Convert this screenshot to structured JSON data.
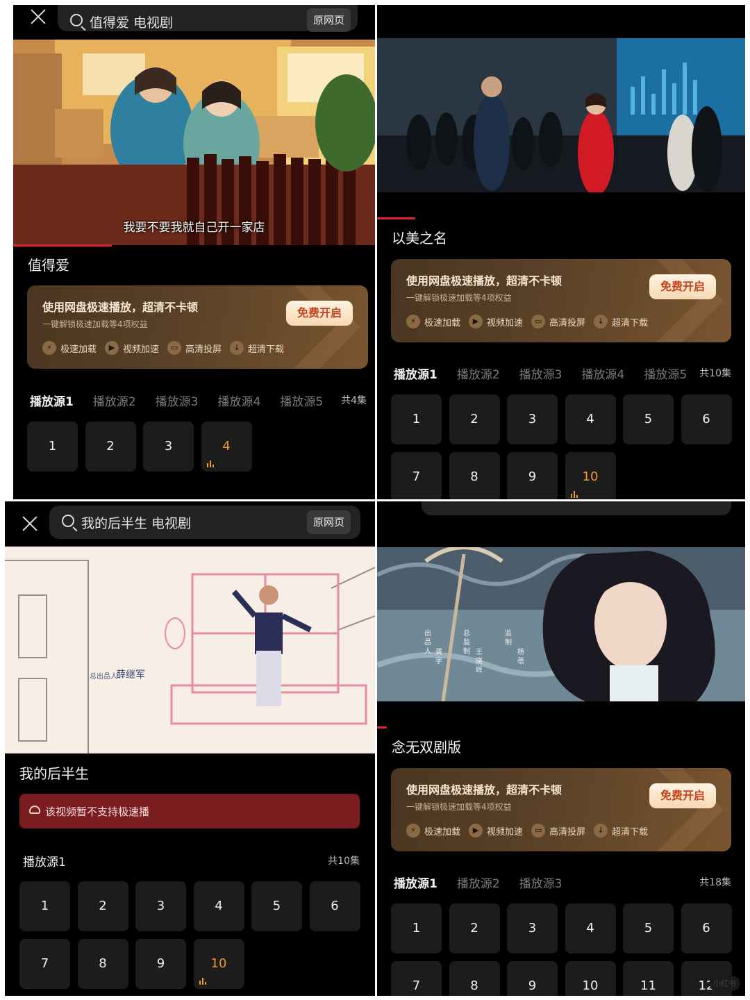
{
  "panels": [
    {
      "search": {
        "query": "值得爱 电视剧",
        "original_page": "原网页"
      },
      "subtitle": "我要不要我就自己开一家店",
      "title": "值得爱",
      "promo": {
        "title": "使用网盘极速播放，超清不卡顿",
        "subtitle": "一键解锁极速加载等4项权益",
        "button": "免费开启",
        "features": [
          "极速加载",
          "视频加速",
          "高清投屏",
          "超清下载"
        ]
      },
      "sources": [
        "播放源1",
        "播放源2",
        "播放源3",
        "播放源4",
        "播放源5"
      ],
      "total": "共4集",
      "episodes": [
        "1",
        "2",
        "3",
        "4"
      ],
      "current_episode": "4"
    },
    {
      "title": "以美之名",
      "promo": {
        "title": "使用网盘极速播放，超清不卡顿",
        "subtitle": "一键解锁极速加载等4项权益",
        "button": "免费开启",
        "features": [
          "极速加载",
          "视频加速",
          "高清投屏",
          "超清下载"
        ]
      },
      "sources": [
        "播放源1",
        "播放源2",
        "播放源3",
        "播放源4",
        "播放源5"
      ],
      "total": "共10集",
      "episodes": [
        "1",
        "2",
        "3",
        "4",
        "5",
        "6",
        "7",
        "8",
        "9",
        "10"
      ],
      "current_episode": "10"
    },
    {
      "search": {
        "query": "我的后半生 电视剧",
        "original_page": "原网页"
      },
      "video_credit": {
        "role": "总出品人",
        "name": "薛继军"
      },
      "title": "我的后半生",
      "warning": "该视频暂不支持极速播",
      "sources": [
        "播放源1"
      ],
      "total": "共10集",
      "episodes": [
        "1",
        "2",
        "3",
        "4",
        "5",
        "6",
        "7",
        "8",
        "9",
        "10"
      ],
      "current_episode": "10"
    },
    {
      "video_credits": [
        "出品人",
        "龚宇",
        "总监制",
        "王晓晖",
        "监制",
        "杨蓓"
      ],
      "title": "念无双剧版",
      "promo": {
        "title": "使用网盘极速播放，超清不卡顿",
        "subtitle": "一键解锁极速加载等4项权益",
        "button": "免费开启",
        "features": [
          "极速加载",
          "视频加速",
          "高清投屏",
          "超清下载"
        ]
      },
      "sources": [
        "播放源1",
        "播放源2",
        "播放源3"
      ],
      "total": "共18集",
      "episodes": [
        "1",
        "2",
        "3",
        "4",
        "5",
        "6",
        "7",
        "8",
        "9",
        "10",
        "11",
        "12"
      ],
      "current_episode": null,
      "watermark": "小红书"
    }
  ],
  "colors": {
    "accent_red": "#e0262e",
    "current_ep": "#f39a2c",
    "promo_button_text": "#c6441b"
  },
  "icons": {
    "feature_icons": [
      "lightning-icon",
      "fast-forward-icon",
      "cast-icon",
      "download-icon"
    ]
  }
}
